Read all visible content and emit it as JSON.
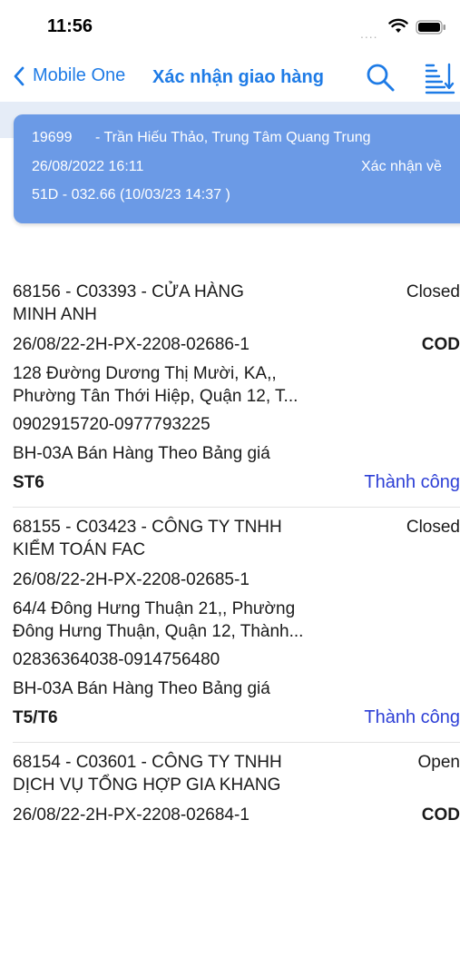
{
  "status_bar": {
    "time": "11:56",
    "signal": "...."
  },
  "nav": {
    "back_label": "Mobile One",
    "title": "Xác nhận giao hàng"
  },
  "summary": {
    "code": "19699",
    "name": "- Trần Hiếu Thảo, Trung Tâm Quang Trung",
    "datetime": "26/08/2022 16:11",
    "status": "Xác nhận về",
    "vehicle": "51D - 032.66 (10/03/23 14:37 )"
  },
  "orders": [
    {
      "title_line1": "68156 - C03393 - CỬA HÀNG",
      "title_line2": "MINH ANH",
      "state": "Closed",
      "doc": "26/08/22-2H-PX-2208-02686-1",
      "payment": "COD",
      "address_line1": "128 Đường Dương Thị Mười, KA,,",
      "address_line2": "Phường  Tân Thới Hiệp, Quận 12, T...",
      "phone": "0902915720-0977793225",
      "price_list": "BH-03A Bán Hàng Theo Bảng giá",
      "route": "ST6",
      "result": "Thành công"
    },
    {
      "title_line1": "68155 - C03423 - CÔNG TY TNHH",
      "title_line2": "KIỂM TOÁN FAC",
      "state": "Closed",
      "doc": "26/08/22-2H-PX-2208-02685-1",
      "payment": "",
      "address_line1": "64/4 Đông Hưng Thuận 21,, Phường",
      "address_line2": "Đông Hưng Thuận, Quận 12, Thành...",
      "phone": "02836364038-0914756480",
      "price_list": "BH-03A Bán Hàng Theo Bảng giá",
      "route": "T5/T6",
      "result": "Thành công"
    },
    {
      "title_line1": "68154 - C03601 - CÔNG TY TNHH",
      "title_line2": "DỊCH VỤ TỔNG HỢP GIA KHANG",
      "state": "Open",
      "doc": "26/08/22-2H-PX-2208-02684-1",
      "payment": "COD"
    }
  ],
  "colors": {
    "accent": "#1e7be6",
    "card": "#6b9ae6",
    "success": "#2d3fd6"
  }
}
